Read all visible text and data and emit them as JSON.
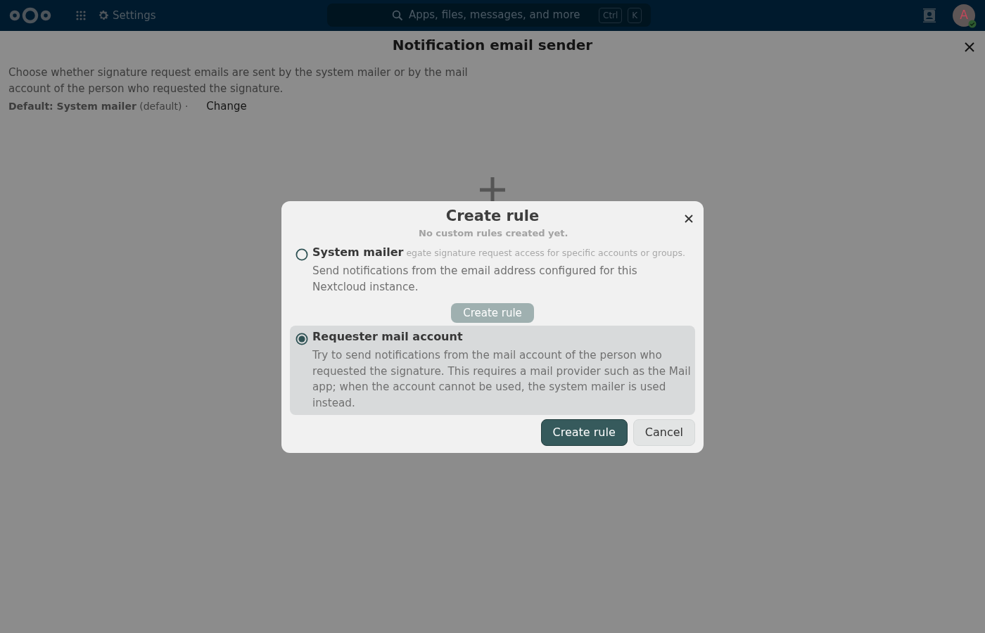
{
  "topbar": {
    "app_menu": "Settings",
    "search": {
      "placeholder": "Apps, files, messages, and more",
      "shortcut_keys": [
        "Ctrl",
        "K"
      ]
    },
    "avatar": {
      "initial": "A",
      "online": true
    }
  },
  "page": {
    "title": "Notification email sender",
    "description": "Choose whether signature request emails are sent by the system mailer or by the mail account of the person who requested the signature.",
    "default_line": "**Default: System mailer** (default) ·",
    "change": "Change",
    "empty_state": {
      "title": "No custom rules created yet.",
      "hint": "egate signature request access for specific accounts or groups.",
      "button": "Create rule"
    }
  },
  "dialog": {
    "title": "Create rule",
    "options": [
      {
        "label": "System mailer",
        "description": "Send notifications from the email address configured for this Nextcloud instance.",
        "selected": false
      },
      {
        "label": "Requester mail account",
        "description": "Try to send notifications from the mail account of the person who requested the signature. This requires a mail provider such as the Mail app; when the account cannot be used, the system mailer is used instead.",
        "selected": true
      }
    ],
    "buttons": [
      {
        "label": "Create rule",
        "kind": "primary"
      },
      {
        "label": "Cancel",
        "kind": "secondary"
      }
    ]
  }
}
